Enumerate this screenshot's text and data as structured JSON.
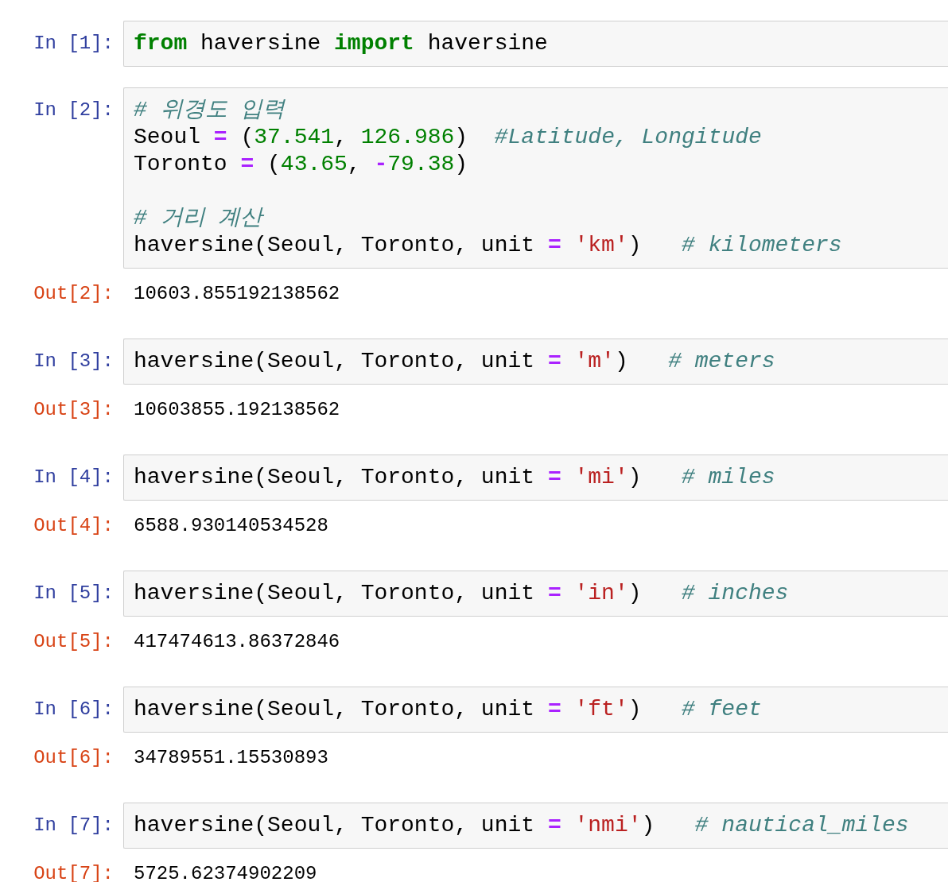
{
  "cells": [
    {
      "prompt": "In [1]:",
      "lines": [
        {
          "kind": "code",
          "tokens": [
            {
              "kind": "keyword",
              "text": "from"
            },
            {
              "kind": "text",
              "text": " haversine "
            },
            {
              "kind": "keyword",
              "text": "import"
            },
            {
              "kind": "text",
              "text": " haversine"
            }
          ]
        }
      ]
    },
    {
      "prompt": "In [2]:",
      "lines": [
        {
          "kind": "code",
          "tokens": [
            {
              "kind": "comment",
              "text": "# 위경도 입력"
            }
          ]
        },
        {
          "kind": "code",
          "tokens": [
            {
              "kind": "text",
              "text": "Seoul "
            },
            {
              "kind": "operator",
              "text": "="
            },
            {
              "kind": "text",
              "text": " ("
            },
            {
              "kind": "number",
              "text": "37.541"
            },
            {
              "kind": "text",
              "text": ", "
            },
            {
              "kind": "number",
              "text": "126.986"
            },
            {
              "kind": "text",
              "text": ")  "
            },
            {
              "kind": "comment",
              "text": "#Latitude, Longitude"
            }
          ]
        },
        {
          "kind": "code",
          "tokens": [
            {
              "kind": "text",
              "text": "Toronto "
            },
            {
              "kind": "operator",
              "text": "="
            },
            {
              "kind": "text",
              "text": " ("
            },
            {
              "kind": "number",
              "text": "43.65"
            },
            {
              "kind": "text",
              "text": ", "
            },
            {
              "kind": "operator",
              "text": "-"
            },
            {
              "kind": "number",
              "text": "79.38"
            },
            {
              "kind": "text",
              "text": ")"
            }
          ]
        },
        {
          "kind": "blank"
        },
        {
          "kind": "code",
          "tokens": [
            {
              "kind": "comment",
              "text": "# 거리 계산"
            }
          ]
        },
        {
          "kind": "code",
          "tokens": [
            {
              "kind": "text",
              "text": "haversine(Seoul, Toronto, unit "
            },
            {
              "kind": "operator",
              "text": "="
            },
            {
              "kind": "string",
              "text": " 'km'"
            },
            {
              "kind": "text",
              "text": ")   "
            },
            {
              "kind": "comment",
              "text": "# kilometers"
            }
          ]
        }
      ],
      "out_prompt": "Out[2]:",
      "output": "10603.855192138562"
    },
    {
      "prompt": "In [3]:",
      "lines": [
        {
          "kind": "code",
          "tokens": [
            {
              "kind": "text",
              "text": "haversine(Seoul, Toronto, unit "
            },
            {
              "kind": "operator",
              "text": "="
            },
            {
              "kind": "string",
              "text": " 'm'"
            },
            {
              "kind": "text",
              "text": ")   "
            },
            {
              "kind": "comment",
              "text": "# meters"
            }
          ]
        }
      ],
      "out_prompt": "Out[3]:",
      "output": "10603855.192138562"
    },
    {
      "prompt": "In [4]:",
      "lines": [
        {
          "kind": "code",
          "tokens": [
            {
              "kind": "text",
              "text": "haversine(Seoul, Toronto, unit "
            },
            {
              "kind": "operator",
              "text": "="
            },
            {
              "kind": "string",
              "text": " 'mi'"
            },
            {
              "kind": "text",
              "text": ")   "
            },
            {
              "kind": "comment",
              "text": "# miles"
            }
          ]
        }
      ],
      "out_prompt": "Out[4]:",
      "output": "6588.930140534528"
    },
    {
      "prompt": "In [5]:",
      "lines": [
        {
          "kind": "code",
          "tokens": [
            {
              "kind": "text",
              "text": "haversine(Seoul, Toronto, unit "
            },
            {
              "kind": "operator",
              "text": "="
            },
            {
              "kind": "string",
              "text": " 'in'"
            },
            {
              "kind": "text",
              "text": ")   "
            },
            {
              "kind": "comment",
              "text": "# inches"
            }
          ]
        }
      ],
      "out_prompt": "Out[5]:",
      "output": "417474613.86372846"
    },
    {
      "prompt": "In [6]:",
      "lines": [
        {
          "kind": "code",
          "tokens": [
            {
              "kind": "text",
              "text": "haversine(Seoul, Toronto, unit "
            },
            {
              "kind": "operator",
              "text": "="
            },
            {
              "kind": "string",
              "text": " 'ft'"
            },
            {
              "kind": "text",
              "text": ")   "
            },
            {
              "kind": "comment",
              "text": "# feet"
            }
          ]
        }
      ],
      "out_prompt": "Out[6]:",
      "output": "34789551.15530893"
    },
    {
      "prompt": "In [7]:",
      "lines": [
        {
          "kind": "code",
          "tokens": [
            {
              "kind": "text",
              "text": "haversine(Seoul, Toronto, unit "
            },
            {
              "kind": "operator",
              "text": "="
            },
            {
              "kind": "string",
              "text": " 'nmi'"
            },
            {
              "kind": "text",
              "text": ")   "
            },
            {
              "kind": "comment",
              "text": "# nautical_miles"
            }
          ]
        }
      ],
      "out_prompt": "Out[7]:",
      "output": "5725.62374902209"
    }
  ]
}
